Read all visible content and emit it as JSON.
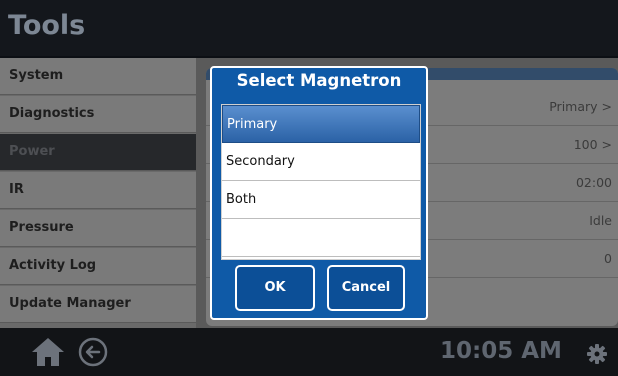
{
  "header": {
    "title": "Tools"
  },
  "sidebar": {
    "items": [
      {
        "label": "System",
        "active": false
      },
      {
        "label": "Diagnostics",
        "active": false
      },
      {
        "label": "Power",
        "active": true
      },
      {
        "label": "IR",
        "active": false
      },
      {
        "label": "Pressure",
        "active": false
      },
      {
        "label": "Activity Log",
        "active": false
      },
      {
        "label": "Update Manager",
        "active": false
      }
    ]
  },
  "content": {
    "rows": [
      {
        "value": "Primary >"
      },
      {
        "value": "100 >"
      },
      {
        "value": "02:00"
      },
      {
        "value": "Idle"
      },
      {
        "value": "0"
      }
    ]
  },
  "dialog": {
    "title": "Select Magnetron",
    "options": [
      {
        "label": "Primary",
        "selected": true
      },
      {
        "label": "Secondary",
        "selected": false
      },
      {
        "label": "Both",
        "selected": false
      },
      {
        "label": "",
        "selected": false
      }
    ],
    "ok_label": "OK",
    "cancel_label": "Cancel"
  },
  "footer": {
    "time": "10:05 AM",
    "icons": [
      "home-icon",
      "back-arrow-icon",
      "gear-icon"
    ]
  },
  "colors": {
    "dialog_blue": "#0f5aa7",
    "selected_option": "#2b62a6",
    "header_title": "#7d8794"
  }
}
